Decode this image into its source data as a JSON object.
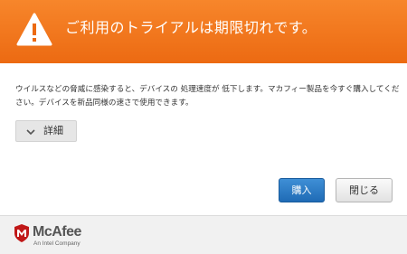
{
  "header": {
    "title": "ご利用のトライアルは期限切れです。",
    "warning_icon": "warning-triangle-icon",
    "background_color": "#f17a1f"
  },
  "body": {
    "message": "ウイルスなどの脅威に感染すると、デバイスの 処理速度が 低下します。マカフィー製品を今すぐ購入してください。デバイスを新品同様の速さで使用できます。",
    "details_label": "詳細",
    "details_icon": "chevron-down-icon"
  },
  "buttons": {
    "buy_label": "購入",
    "close_label": "閉じる",
    "buy_color": "#2a7bc6"
  },
  "footer": {
    "brand": "McAfee",
    "brand_sub": "An Intel Company",
    "logo_icon": "mcafee-shield-icon",
    "brand_color": "#c01818"
  }
}
